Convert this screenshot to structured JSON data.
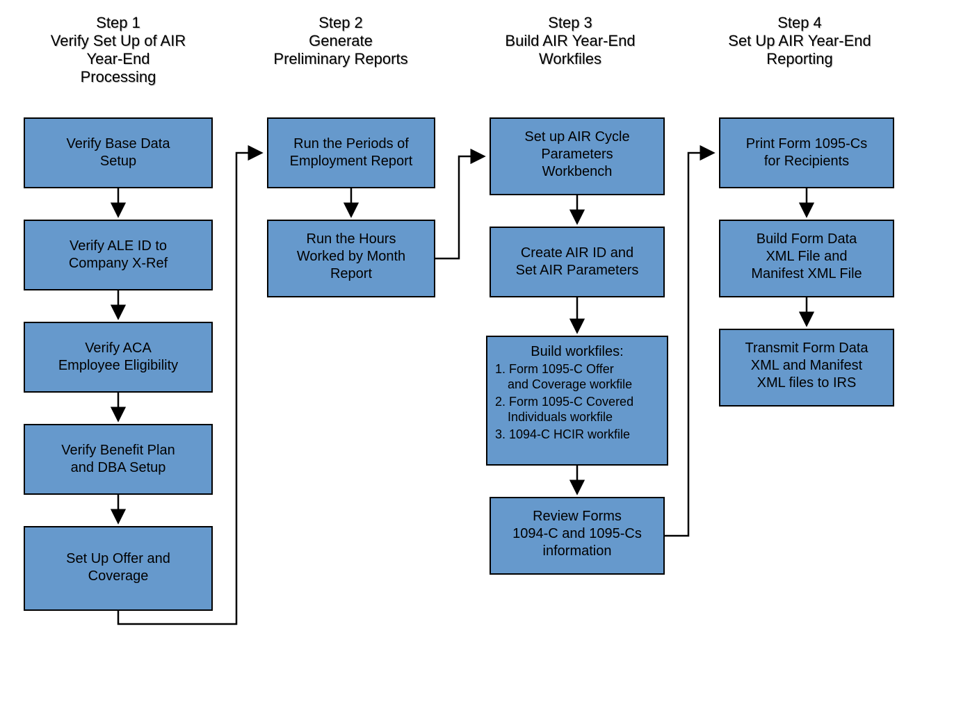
{
  "columns": [
    {
      "heading": [
        "Step 1",
        "Verify Set Up of AIR",
        "Year-End",
        "Processing"
      ]
    },
    {
      "heading": [
        "Step 2",
        "Generate",
        "Preliminary Reports"
      ]
    },
    {
      "heading": [
        "Step 3",
        "Build AIR Year-End",
        "Workfiles"
      ]
    },
    {
      "heading": [
        "Step 4",
        "Set Up AIR Year-End",
        "Reporting"
      ]
    }
  ],
  "step1": {
    "b1": [
      "Verify Base Data",
      "Setup"
    ],
    "b2": [
      "Verify ALE ID to",
      "Company X-Ref"
    ],
    "b3": [
      "Verify ACA",
      "Employee Eligibility"
    ],
    "b4": [
      "Verify Benefit Plan",
      "and DBA Setup"
    ],
    "b5": [
      "Set Up Offer and",
      "Coverage"
    ]
  },
  "step2": {
    "b1": [
      "Run the Periods of",
      "Employment Report"
    ],
    "b2": [
      "Run the Hours",
      "Worked by Month",
      "Report"
    ]
  },
  "step3": {
    "b1": [
      "Set up AIR Cycle",
      "Parameters",
      "Workbench"
    ],
    "b2": [
      "Create AIR ID and",
      "Set AIR Parameters"
    ],
    "b3_title": "Build workfiles:",
    "b3_items": [
      [
        "1. Form 1095-C Offer",
        "and Coverage workfile"
      ],
      [
        "2. Form 1095-C Covered",
        "Individuals workfile"
      ],
      [
        "3. 1094-C HCIR workfile"
      ]
    ],
    "b4": [
      "Review Forms",
      "1094-C and 1095-Cs",
      "information"
    ]
  },
  "step4": {
    "b1": [
      "Print  Form 1095-Cs",
      "for Recipients"
    ],
    "b2": [
      "Build Form Data",
      "XML File and",
      "Manifest XML File"
    ],
    "b3": [
      "Transmit Form Data",
      "XML and Manifest",
      "XML files to IRS"
    ]
  }
}
